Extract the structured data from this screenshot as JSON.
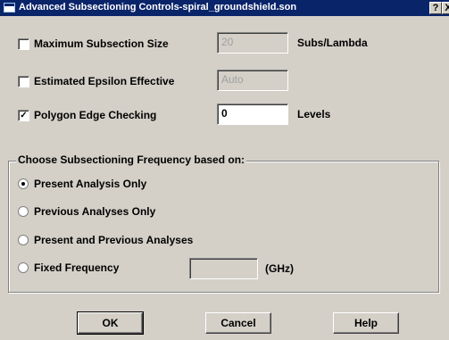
{
  "window": {
    "title": "Advanced Subsectioning Controls-spiral_groundshield.son",
    "help_glyph": "?",
    "close_glyph": "X"
  },
  "options": {
    "max_subsection": {
      "label": "Maximum Subsection Size",
      "checked": false,
      "value": "20",
      "unit": "Subs/Lambda"
    },
    "eps_effective": {
      "label": "Estimated Epsilon Effective",
      "checked": false,
      "value": "Auto"
    },
    "polygon_edge": {
      "label": "Polygon Edge Checking",
      "checked": true,
      "check_glyph": "✓",
      "value": "0",
      "unit": "Levels"
    }
  },
  "frequency_group": {
    "legend": "Choose Subsectioning Frequency based on:",
    "options": [
      {
        "label": "Present Analysis Only",
        "selected": true
      },
      {
        "label": "Previous Analyses Only",
        "selected": false
      },
      {
        "label": "Present and Previous Analyses",
        "selected": false
      },
      {
        "label": "Fixed Frequency",
        "selected": false
      }
    ],
    "fixed_value": "",
    "fixed_unit": "(GHz)"
  },
  "buttons": {
    "ok": "OK",
    "cancel": "Cancel",
    "help": "Help"
  }
}
